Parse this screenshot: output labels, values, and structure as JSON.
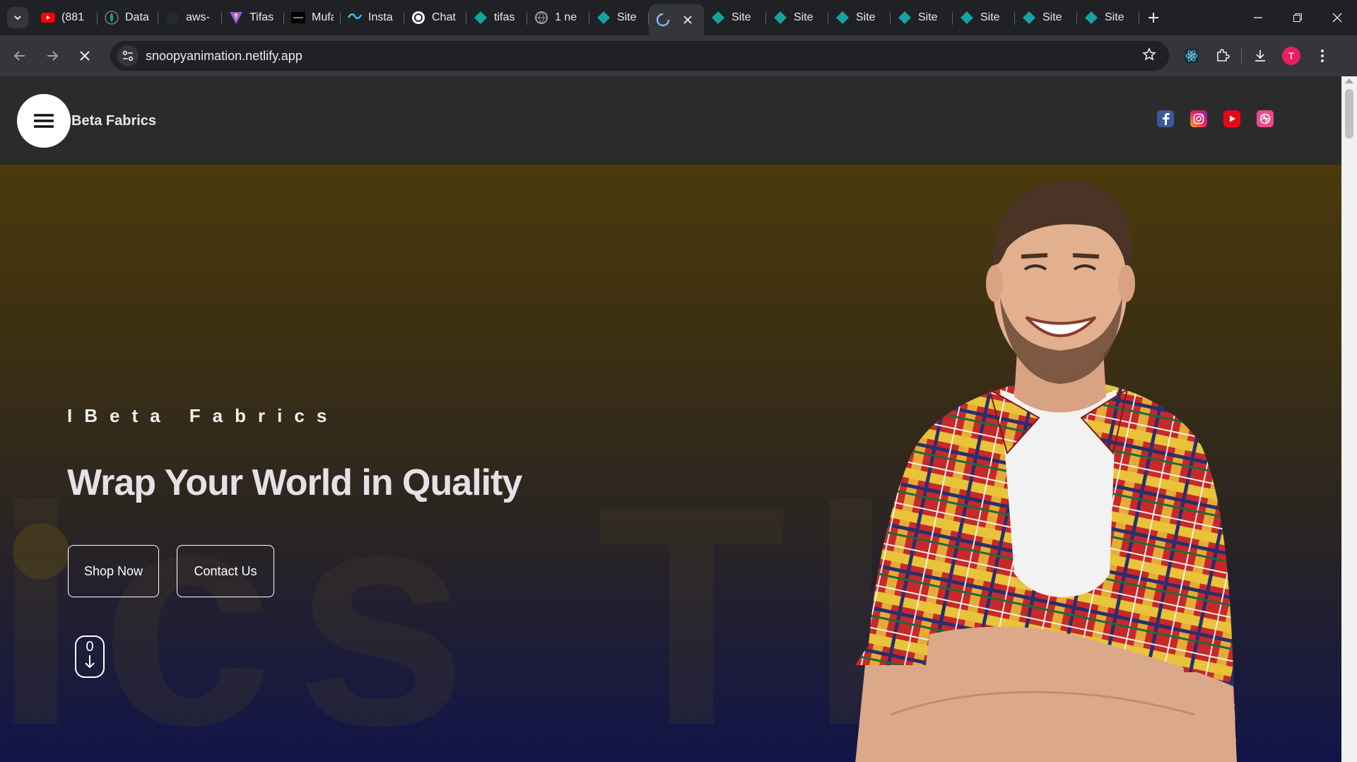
{
  "browser": {
    "tabs": [
      {
        "title": "(881",
        "icon": "youtube-icon",
        "active": false
      },
      {
        "title": "Data",
        "icon": "mongodb-icon",
        "active": false
      },
      {
        "title": "aws-",
        "icon": "github-icon",
        "active": false
      },
      {
        "title": "Tifas",
        "icon": "vite-icon",
        "active": false
      },
      {
        "title": "Mufa",
        "icon": "site-icon",
        "active": false
      },
      {
        "title": "Insta",
        "icon": "tailwind-icon",
        "active": false
      },
      {
        "title": "Chat",
        "icon": "chatgpt-icon",
        "active": false
      },
      {
        "title": "tifas",
        "icon": "netlify-icon",
        "active": false
      },
      {
        "title": "1 ne",
        "icon": "globe-icon",
        "active": false
      },
      {
        "title": "Site",
        "icon": "netlify-icon",
        "active": false
      },
      {
        "title": "",
        "icon": "loading-icon",
        "active": true
      },
      {
        "title": "Site",
        "icon": "netlify-icon",
        "active": false
      },
      {
        "title": "Site",
        "icon": "netlify-icon",
        "active": false
      },
      {
        "title": "Site",
        "icon": "netlify-icon",
        "active": false
      },
      {
        "title": "Site",
        "icon": "netlify-icon",
        "active": false
      },
      {
        "title": "Site",
        "icon": "netlify-icon",
        "active": false
      },
      {
        "title": "Site",
        "icon": "netlify-icon",
        "active": false
      },
      {
        "title": "Site",
        "icon": "netlify-icon",
        "active": false
      }
    ],
    "url": "snoopyanimation.netlify.app",
    "profile_initial": "T"
  },
  "site": {
    "brand": "Beta Fabrics",
    "socials": [
      "facebook-icon",
      "instagram-icon",
      "youtube-icon",
      "dribbble-icon"
    ],
    "hero": {
      "eyebrow": "IBeta Fabrics",
      "headline": "Wrap Your World in Quality",
      "shop_label": "Shop Now",
      "contact_label": "Contact Us",
      "scroll_number": "0",
      "background_text": "ics Th"
    }
  },
  "colors": {
    "accent_netlify": "#15a3a1",
    "hero_top": "#4a3a0c",
    "hero_bottom": "#111448",
    "header_bg": "#2b2b2b"
  }
}
